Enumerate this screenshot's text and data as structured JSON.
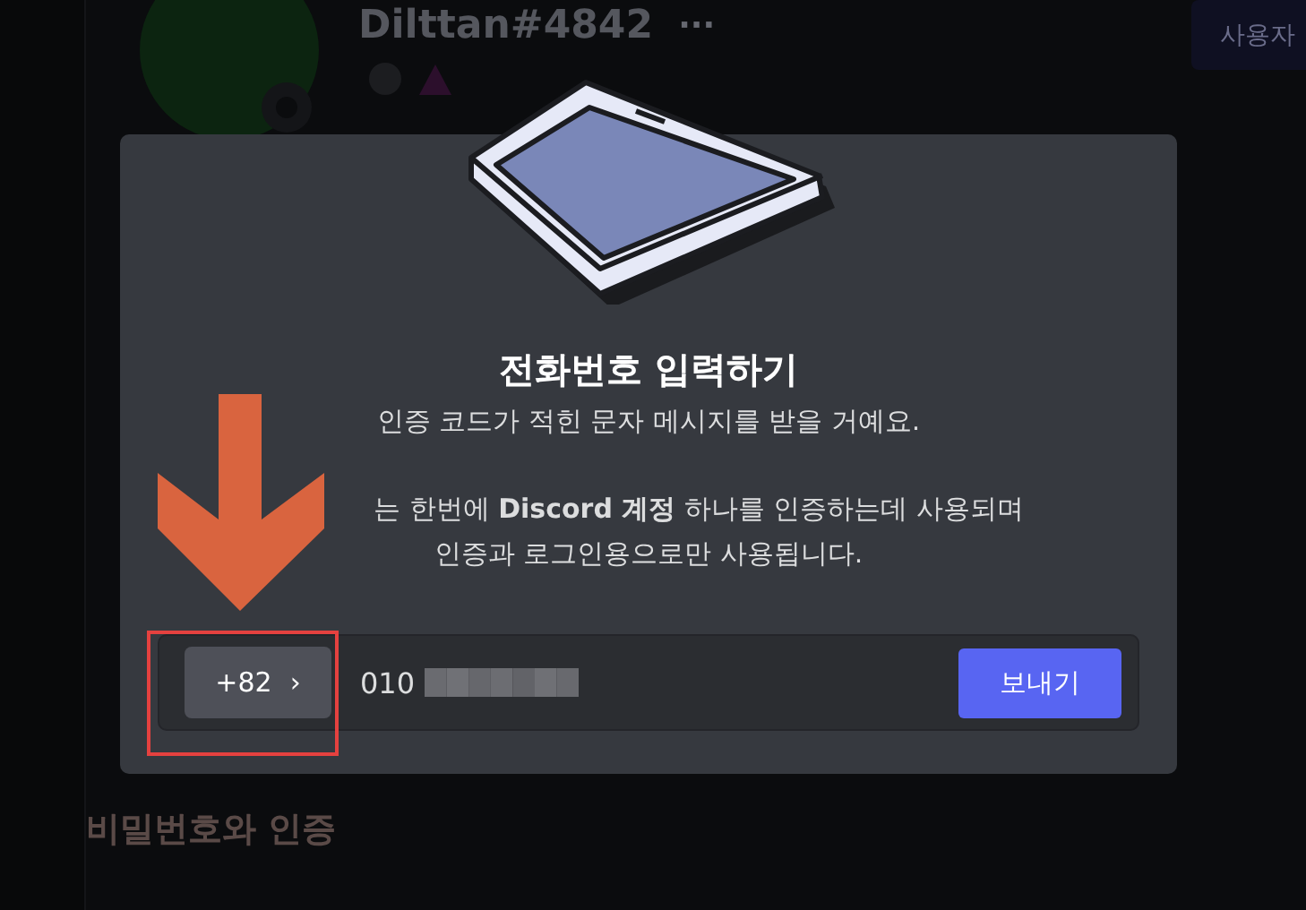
{
  "profile": {
    "username": "Dilttan#4842",
    "more": "···",
    "edit_button": "사용자"
  },
  "section_heading": "비밀번호와 인증",
  "dialog": {
    "title": "전화번호 입력하기",
    "subtitle": "인증 코드가 적힌 문자 메시지를 받을 거예요.",
    "notice_lines": [
      "는 한번에 **Discord 계정** 하나를 인증하는데 사용되며",
      "인증과 로그인용으로만 사용됩니다."
    ],
    "country_code": "+82",
    "chevron": "›",
    "phone_value": "010",
    "send_button": "보내기"
  }
}
